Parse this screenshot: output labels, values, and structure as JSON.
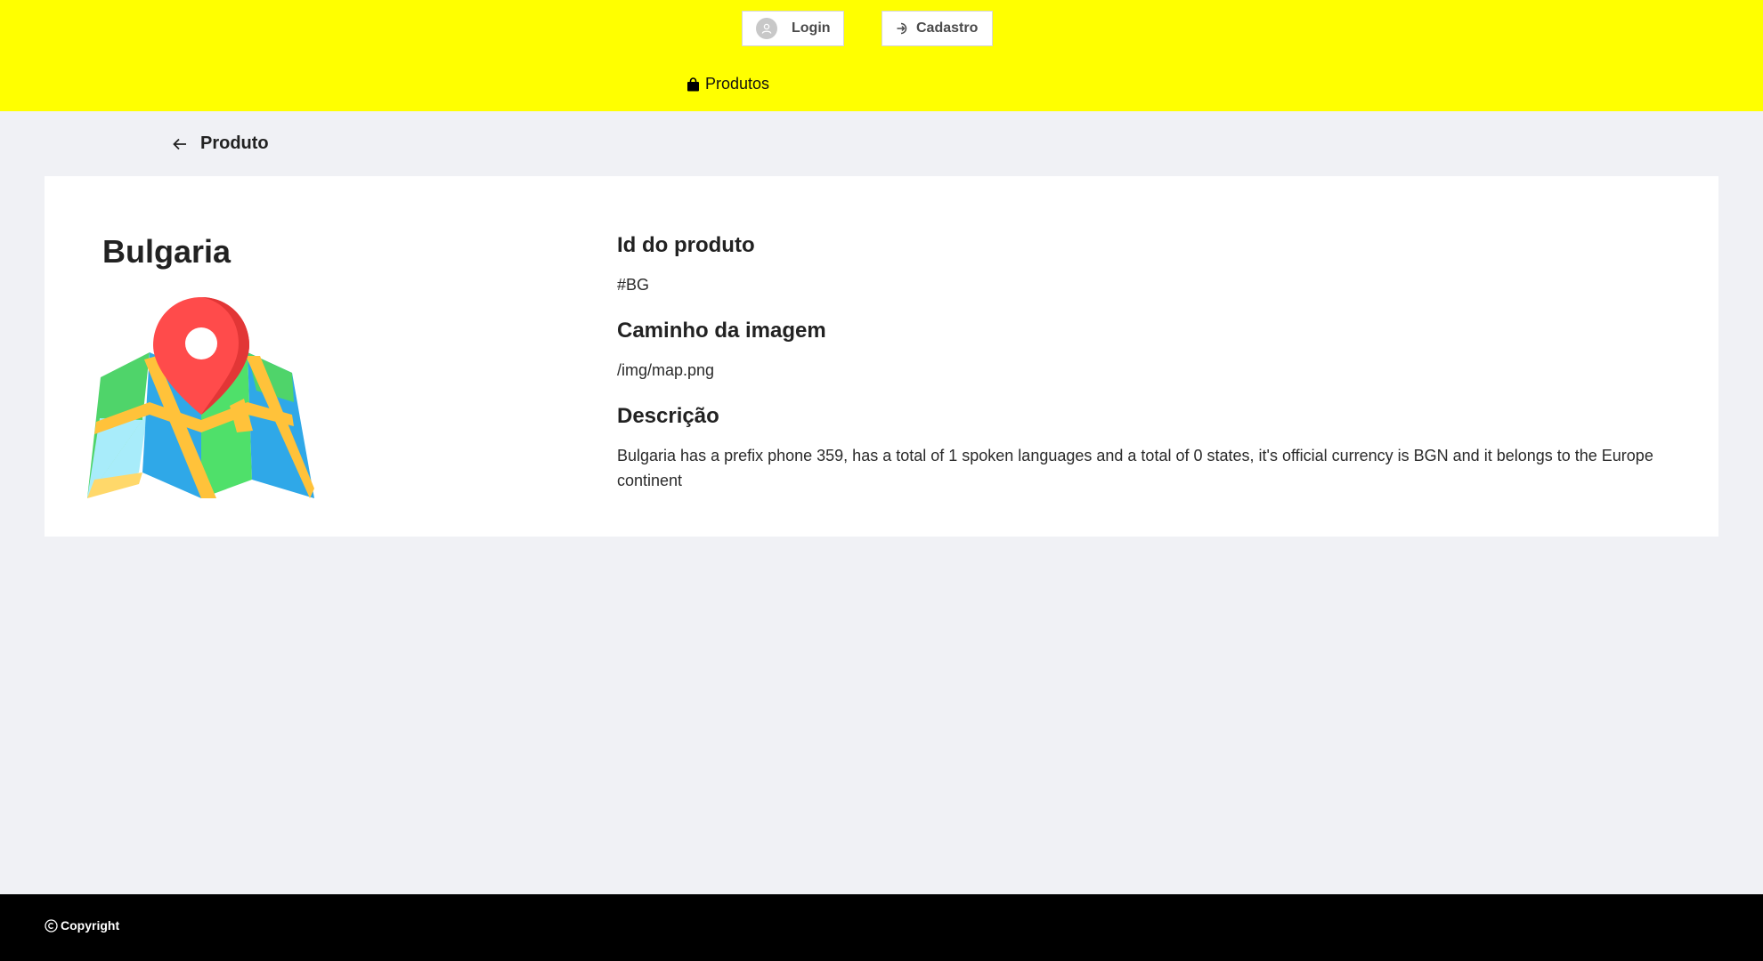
{
  "header": {
    "login_label": "Login",
    "signup_label": "Cadastro",
    "nav_products_label": "Produtos",
    "background_color": "#ffff00",
    "icons": [
      "avatar-icon",
      "sign-in-icon",
      "shopping-bag-icon"
    ]
  },
  "page": {
    "title": "Produto",
    "back_icon": "arrow-left-icon"
  },
  "product": {
    "name": "Bulgaria",
    "image_icon": "map-pin-icon",
    "id_label": "Id do produto",
    "id_value": "#BG",
    "image_path_label": "Caminho da imagem",
    "image_path_value": "/img/map.png",
    "description_label": "Descrição",
    "description_value": "Bulgaria has a prefix phone 359, has a total of 1 spoken languages and a total of 0 states, it's official currency is BGN and it belongs to the Europe continent"
  },
  "footer": {
    "copyright_label": "Copyright",
    "copyright_icon": "copyright-icon",
    "background_color": "#000000"
  }
}
